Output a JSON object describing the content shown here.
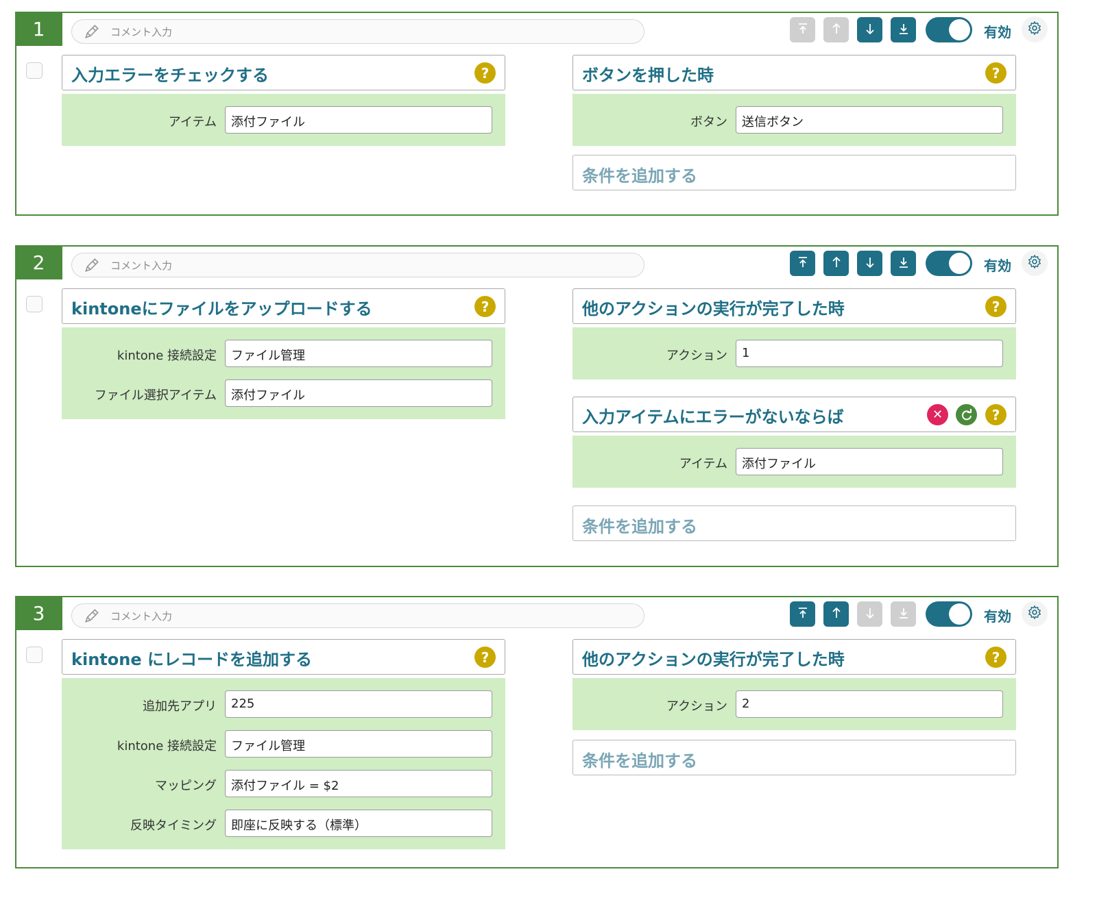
{
  "common": {
    "comment_placeholder": "コメント入力",
    "valid_label": "有効",
    "add_condition": "条件を追加する",
    "help": "?"
  },
  "blocks": [
    {
      "number": "1",
      "action": {
        "title": "入力エラーをチェックする",
        "fields": [
          {
            "label": "アイテム",
            "value": "添付ファイル"
          }
        ]
      },
      "conditions": [
        {
          "title": "ボタンを押した時",
          "fields": [
            {
              "label": "ボタン",
              "value": "送信ボタン"
            }
          ]
        }
      ],
      "controls": {
        "top": "disabled",
        "up": "disabled",
        "down": "enabled",
        "bottom": "enabled"
      }
    },
    {
      "number": "2",
      "action": {
        "title": "kintoneにファイルをアップロードする",
        "fields": [
          {
            "label": "kintone 接続設定",
            "value": "ファイル管理"
          },
          {
            "label": "ファイル選択アイテム",
            "value": "添付ファイル"
          }
        ]
      },
      "conditions": [
        {
          "title": "他のアクションの実行が完了した時",
          "fields": [
            {
              "label": "アクション",
              "value": "1"
            }
          ]
        },
        {
          "title": "入力アイテムにエラーがないならば",
          "fields": [
            {
              "label": "アイテム",
              "value": "添付ファイル"
            }
          ]
        }
      ],
      "controls": {
        "top": "enabled",
        "up": "enabled",
        "down": "enabled",
        "bottom": "enabled"
      }
    },
    {
      "number": "3",
      "action": {
        "title": "kintone にレコードを追加する",
        "fields": [
          {
            "label": "追加先アプリ",
            "value": "225"
          },
          {
            "label": "kintone 接続設定",
            "value": "ファイル管理"
          },
          {
            "label": "マッピング",
            "value": "添付ファイル = $2"
          },
          {
            "label": "反映タイミング",
            "value": "即座に反映する（標準）"
          }
        ]
      },
      "conditions": [
        {
          "title": "他のアクションの実行が完了した時",
          "fields": [
            {
              "label": "アクション",
              "value": "2"
            }
          ]
        }
      ],
      "controls": {
        "top": "enabled",
        "up": "enabled",
        "down": "disabled",
        "bottom": "disabled"
      }
    }
  ],
  "colors": {
    "green": "#4a8a3c",
    "teal": "#1f6f86",
    "panel": "#d0edc4",
    "help": "#c9a900",
    "remove": "#e0245e"
  },
  "icons": [
    "pencil-icon",
    "move-top-icon",
    "move-up-icon",
    "move-down-icon",
    "move-bottom-icon",
    "gear-icon",
    "help-icon",
    "close-icon",
    "refresh-icon"
  ]
}
